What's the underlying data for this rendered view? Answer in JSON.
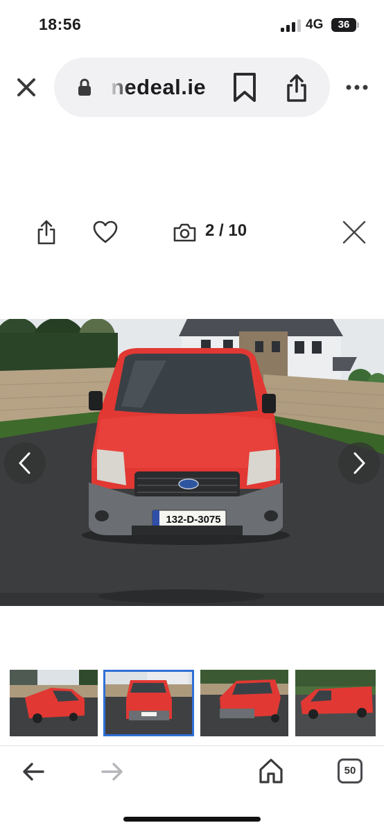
{
  "status_bar": {
    "time": "18:56",
    "network": "4G",
    "battery": "36",
    "signal_bars_filled": 3,
    "signal_bars_total": 4
  },
  "browser": {
    "url_display": "nedeal.ie",
    "icons": [
      "close-icon",
      "lock-icon",
      "bookmark-icon",
      "share-icon",
      "more-icon"
    ]
  },
  "gallery": {
    "current": 2,
    "total": 10,
    "counter_label": "2 / 10",
    "icons": [
      "share-icon",
      "heart-icon",
      "camera-icon",
      "close-icon"
    ],
    "main_photo": {
      "subject": "red van front view",
      "plate_text": "132-D-3075",
      "colors": {
        "van": "#e63a35",
        "bumper": "#6b6e72",
        "ground": "#3d3e40",
        "sky": "#e6e9ec",
        "wall": "#b19e84"
      }
    },
    "thumbnails": [
      {
        "active": false,
        "view": "front-left"
      },
      {
        "active": true,
        "view": "front"
      },
      {
        "active": false,
        "view": "front-right"
      },
      {
        "active": false,
        "view": "side"
      }
    ],
    "accent_color": "#2f6fd6"
  },
  "bottom_nav": {
    "tabs_count": "50",
    "icons": [
      "back-arrow-icon",
      "forward-arrow-icon",
      "home-icon",
      "tabs-icon"
    ]
  }
}
